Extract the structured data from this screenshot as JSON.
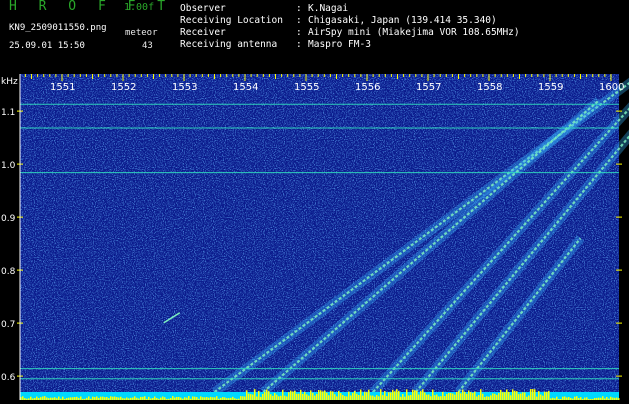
{
  "header": {
    "app_title": "H R O F F T",
    "app_version": "1.00f",
    "file_name": "KN9_2509011550.png",
    "meteor_label": "meteor",
    "meteor_count": "43",
    "date_time": "25.09.01 15:50",
    "info": [
      {
        "key": "Observer",
        "value": "K.Nagai"
      },
      {
        "key": "Receiving Location",
        "value": "Chigasaki, Japan (139.414 35.340)"
      },
      {
        "key": "Receiver",
        "value": "AirSpy mini (Miakejima VOR 108.65MHz)"
      },
      {
        "key": "Receiving antenna",
        "value": "Maspro FM-3"
      }
    ]
  },
  "chart_data": {
    "type": "heatmap",
    "title": "",
    "ylabel": "kHz",
    "x_tick_labels": [
      "1551",
      "1552",
      "1553",
      "1554",
      "1555",
      "1556",
      "1557",
      "1558",
      "1559",
      "1600"
    ],
    "y_tick_labels": [
      "1.1",
      "1.0",
      "0.9",
      "0.8",
      "0.7",
      "0.6"
    ],
    "y_ticks": [
      1.1,
      1.0,
      0.9,
      0.8,
      0.7,
      0.6
    ],
    "ylim": [
      0.57,
      1.17
    ],
    "x_minutes_range": [
      0,
      10
    ],
    "horizontal_lines_khz": [
      1.113,
      1.068,
      0.984,
      0.614,
      0.595
    ],
    "drift_traces": [
      {
        "start": [
          3.0,
          0.57
        ],
        "end": [
          10.0,
          1.17
        ]
      },
      {
        "start": [
          3.8,
          0.57
        ],
        "end": [
          9.3,
          1.12
        ]
      },
      {
        "start": [
          5.6,
          0.57
        ],
        "end": [
          10.0,
          1.13
        ]
      },
      {
        "start": [
          6.3,
          0.57
        ],
        "end": [
          10.0,
          1.08
        ]
      },
      {
        "start": [
          7.0,
          0.57
        ],
        "end": [
          9.0,
          0.86
        ]
      }
    ],
    "meteor_echoes": [
      {
        "x": 2.3,
        "y": 0.71
      }
    ],
    "colors": {
      "background": "#0a1a8c",
      "noise_low": "#1e45c8",
      "noise_high": "#37b6ff",
      "signal": "#7cf0c0",
      "line": "#30e0c0",
      "bottom_band": "#00d8ff",
      "bottom_spikes": "#ffff00",
      "ticks": "#ffff00"
    }
  }
}
